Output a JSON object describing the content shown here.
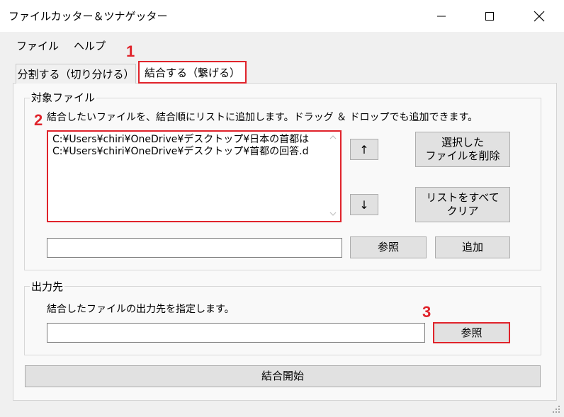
{
  "window": {
    "title": "ファイルカッター＆ツナゲッター"
  },
  "menu": {
    "items": [
      {
        "label": "ファイル"
      },
      {
        "label": "ヘルプ"
      }
    ]
  },
  "tabs": [
    {
      "label": "分割する（切り分ける）",
      "selected": false
    },
    {
      "label": "結合する（繋げる）",
      "selected": true
    }
  ],
  "target_files": {
    "legend": "対象ファイル",
    "instruction": "結合したいファイルを、結合順にリストに追加します。ドラッグ ＆ ドロップでも追加できます。",
    "list_items": [
      "C:¥Users¥chiri¥OneDrive¥デスクトップ¥日本の首都は",
      "C:¥Users¥chiri¥OneDrive¥デスクトップ¥首都の回答.d"
    ],
    "move_up_label": "↑",
    "move_down_label": "↓",
    "delete_selected_label_line1": "選択した",
    "delete_selected_label_line2": "ファイルを削除",
    "clear_all_label_line1": "リストをすべて",
    "clear_all_label_line2": "クリア",
    "path_input_value": "",
    "browse_label": "参照",
    "add_label": "追加"
  },
  "output": {
    "legend": "出力先",
    "instruction": "結合したファイルの出力先を指定します。",
    "path_input_value": "",
    "browse_label": "参照"
  },
  "start_join_label": "結合開始",
  "callouts": {
    "c1": "1",
    "c2": "2",
    "c3": "3"
  },
  "colors": {
    "highlight": "#e0232b",
    "button_face": "#e1e1e1",
    "window_bg": "#f0f0f0",
    "panel_bg": "#f9f9f9"
  },
  "icons": {
    "minimize": "minimize-icon",
    "maximize": "maximize-icon",
    "close": "close-icon",
    "scroll_up": "chevron-up-icon",
    "scroll_down": "chevron-down-icon",
    "resize_grip": "resize-grip-icon"
  }
}
